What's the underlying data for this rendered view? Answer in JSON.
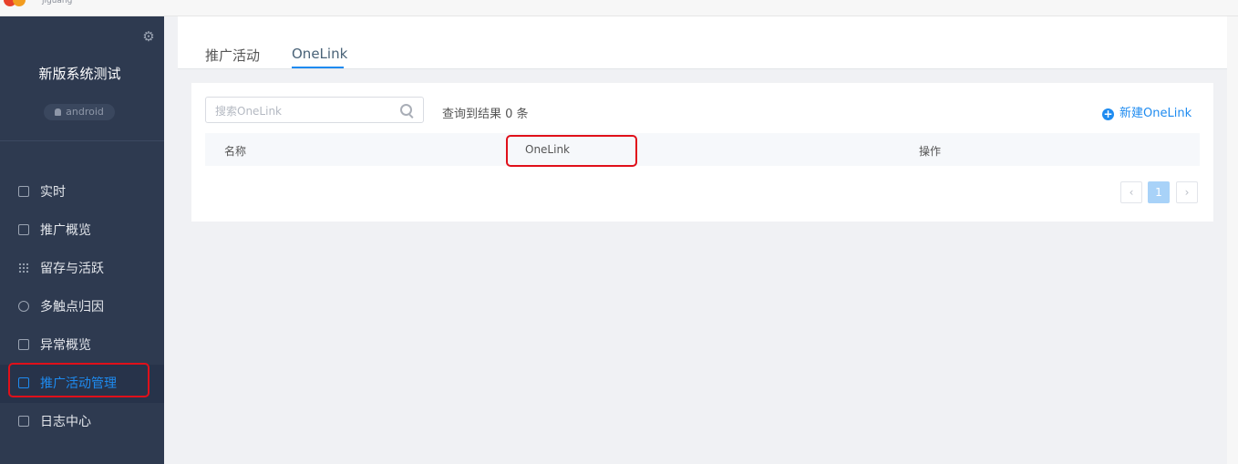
{
  "brand": {
    "logo_text": "jiguang"
  },
  "app": {
    "name": "新版系统测试",
    "platform": "android"
  },
  "nav": {
    "items": [
      {
        "label": "实时",
        "icon": "clock-doc-icon",
        "active": false
      },
      {
        "label": "推广概览",
        "icon": "chart-image-icon",
        "active": false
      },
      {
        "label": "留存与活跃",
        "icon": "dot-grid-icon",
        "active": false
      },
      {
        "label": "多触点归因",
        "icon": "target-icon",
        "active": false
      },
      {
        "label": "异常概览",
        "icon": "alert-doc-icon",
        "active": false
      },
      {
        "label": "推广活动管理",
        "icon": "folder-gear-icon",
        "active": true
      },
      {
        "label": "日志中心",
        "icon": "log-doc-icon",
        "active": false
      }
    ]
  },
  "tabs": [
    {
      "label": "推广活动",
      "active": false
    },
    {
      "label": "OneLink",
      "active": true
    }
  ],
  "toolbar": {
    "search_placeholder": "搜索OneLink",
    "result_count": "查询到结果 0 条",
    "new_button": "新建OneLink"
  },
  "table": {
    "columns": [
      "名称",
      "OneLink",
      "操作"
    ],
    "rows": []
  },
  "pagination": {
    "prev": "‹",
    "current": "1",
    "next": "›"
  },
  "colors": {
    "accent": "#1e8bf0",
    "sidebar": "#2e3a50",
    "highlight": "#e0101a"
  }
}
